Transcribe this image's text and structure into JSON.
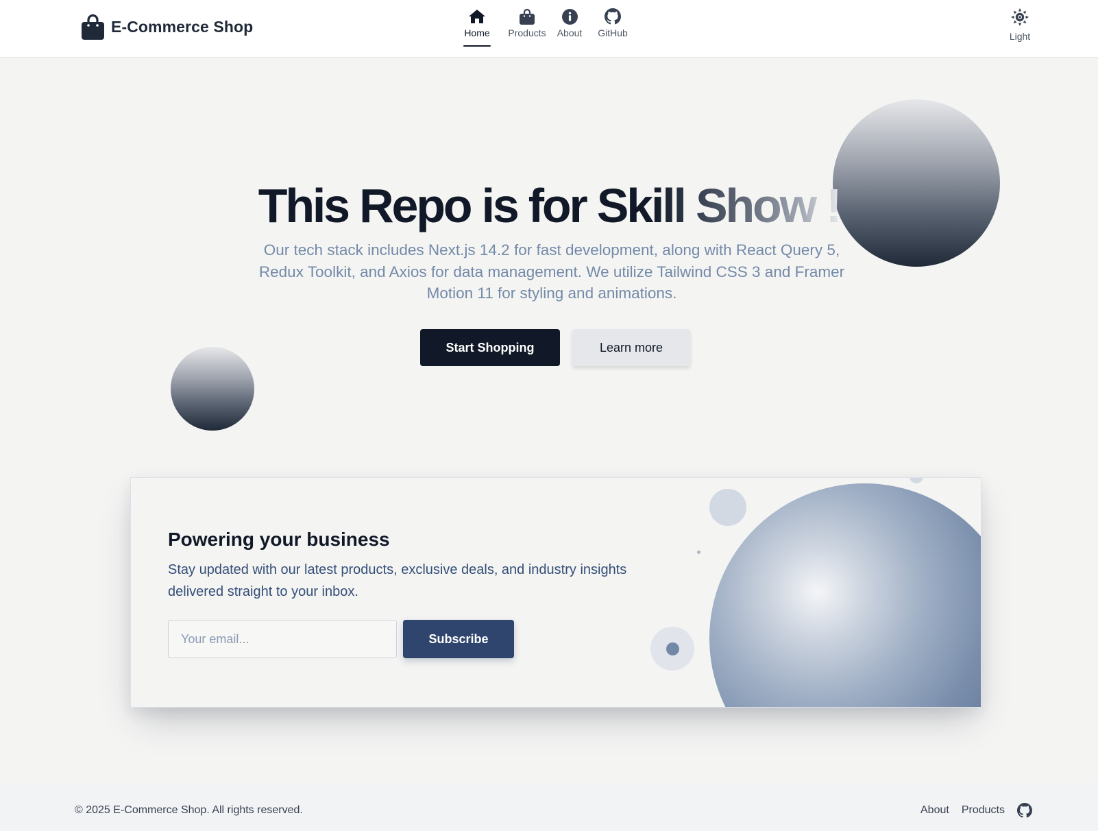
{
  "header": {
    "brand": {
      "name": "E-Commerce Shop",
      "icon": "shopping-bag-icon"
    },
    "nav": [
      {
        "label": "Home",
        "icon": "home-icon",
        "active": true
      },
      {
        "label": "Products",
        "icon": "shopping-bag-icon",
        "active": false
      },
      {
        "label": "About",
        "icon": "info-icon",
        "active": false
      },
      {
        "label": "GitHub",
        "icon": "github-icon",
        "active": false
      }
    ],
    "theme_toggle": {
      "label": "Light",
      "icon": "sun-icon"
    }
  },
  "hero": {
    "title_main": "This Repo is for Sk",
    "title_gradient": "ill Show !",
    "description": "Our tech stack includes Next.js 14.2 for fast development, along with React Query 5, Redux Toolkit, and Axios for data management. We utilize Tailwind CSS 3 and Framer Motion 11 for styling and animations.",
    "primary_button": "Start Shopping",
    "secondary_button": "Learn more"
  },
  "newsletter": {
    "title": "Powering your business",
    "text": "Stay updated with our latest products, exclusive deals, and industry insights delivered straight to your inbox.",
    "email_placeholder": "Your email...",
    "email_value": "",
    "subscribe_label": "Subscribe"
  },
  "footer": {
    "copyright": "© 2025 E-Commerce Shop. All rights reserved.",
    "links": [
      "About",
      "Products"
    ],
    "github_icon": "github-icon"
  },
  "colors": {
    "primary_dark": "#111827",
    "accent_navy": "#2f456e",
    "muted_blue_text": "#7389a8",
    "page_background": "#f4f4f3"
  }
}
